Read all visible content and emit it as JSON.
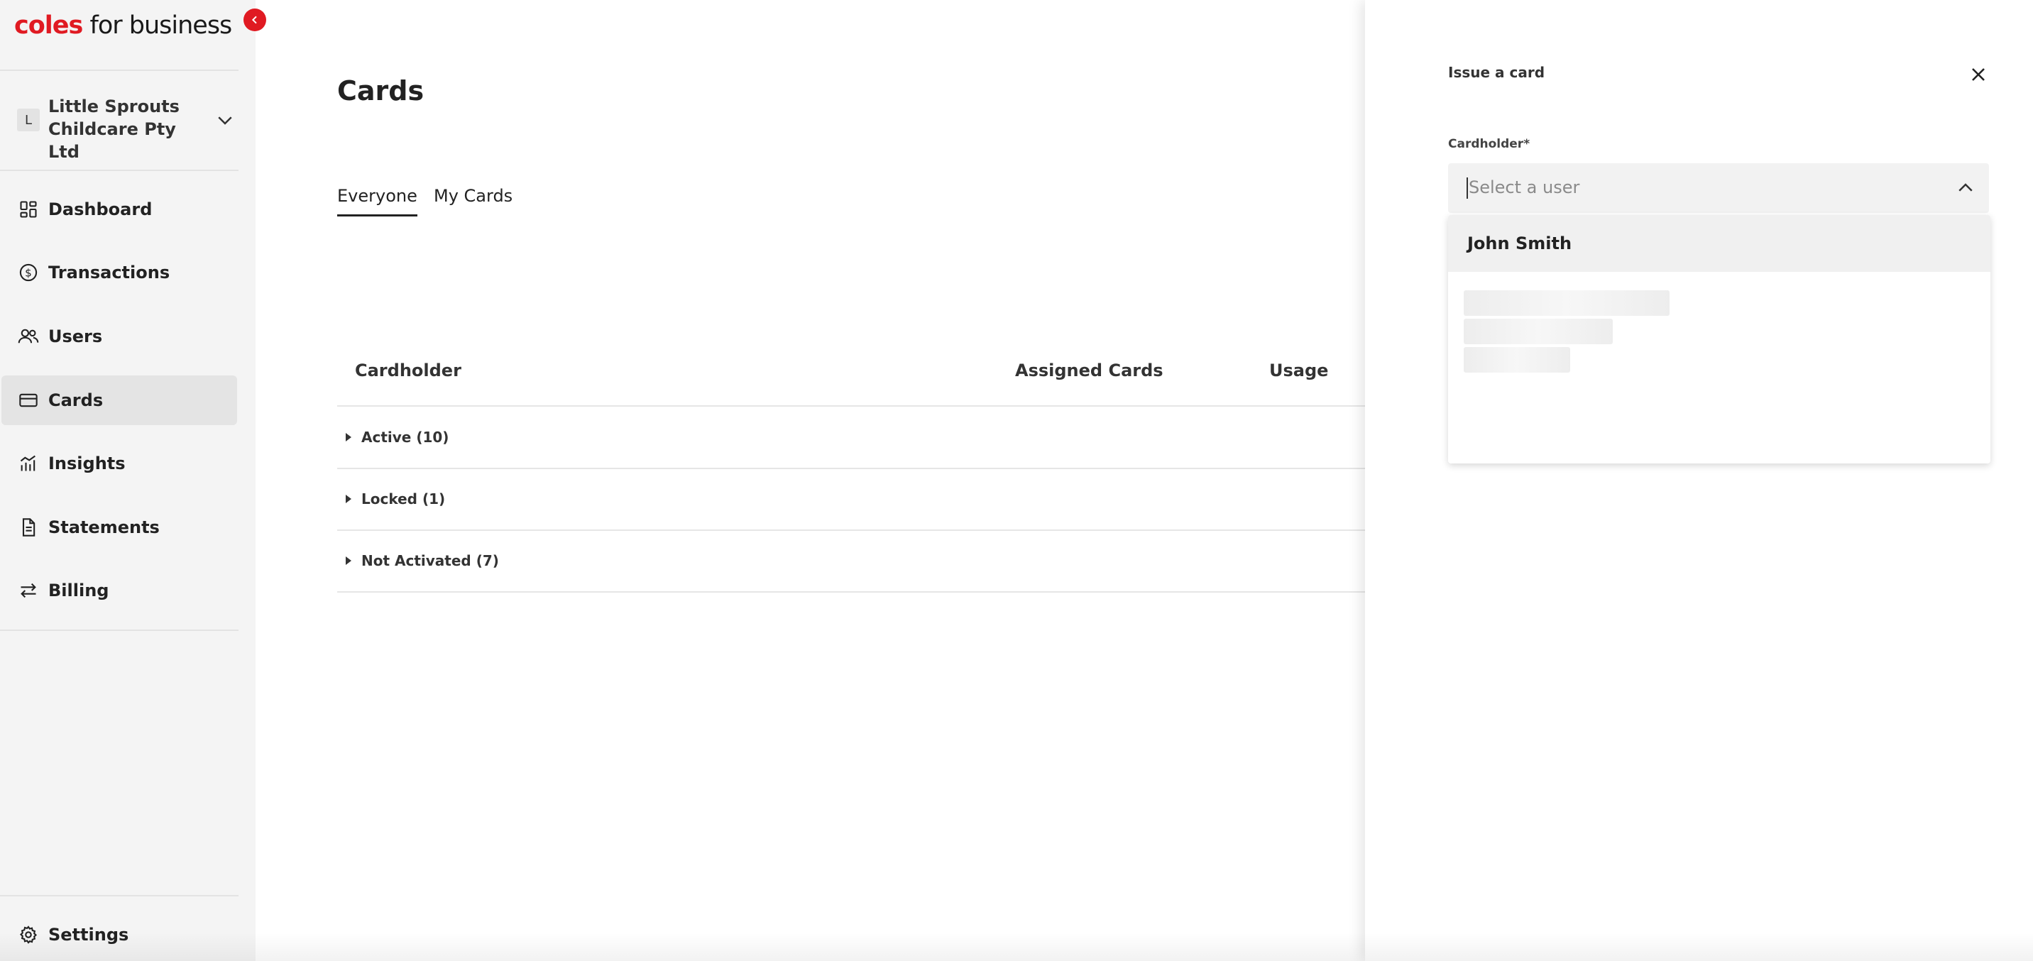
{
  "logo": {
    "brand": "coles",
    "rest": " for business"
  },
  "organization": {
    "initial": "L",
    "name": "Little Sprouts Childcare Pty Ltd"
  },
  "nav": {
    "items": [
      {
        "label": "Dashboard",
        "icon": "dashboard-icon"
      },
      {
        "label": "Transactions",
        "icon": "dollar-circle-icon"
      },
      {
        "label": "Users",
        "icon": "users-icon"
      },
      {
        "label": "Cards",
        "icon": "card-icon",
        "active": true
      },
      {
        "label": "Insights",
        "icon": "insights-icon"
      },
      {
        "label": "Statements",
        "icon": "document-icon"
      },
      {
        "label": "Billing",
        "icon": "transfer-icon"
      }
    ],
    "settings": {
      "label": "Settings",
      "icon": "gear-icon"
    }
  },
  "page": {
    "title": "Cards"
  },
  "tabs": [
    {
      "label": "Everyone",
      "active": true
    },
    {
      "label": "My Cards",
      "active": false
    }
  ],
  "table": {
    "columns": [
      "Cardholder",
      "Assigned Cards",
      "Usage"
    ],
    "groups": [
      "Active (10)",
      "Locked (1)",
      "Not Activated (7)"
    ]
  },
  "panel": {
    "title": "Issue a card",
    "field_label": "Cardholder*",
    "placeholder": "Select a user",
    "options": [
      "John Smith"
    ]
  },
  "colors": {
    "brand": "#e01a22",
    "sidebar_bg": "#f4f4f4",
    "active_nav_bg": "#e4e4e4"
  }
}
